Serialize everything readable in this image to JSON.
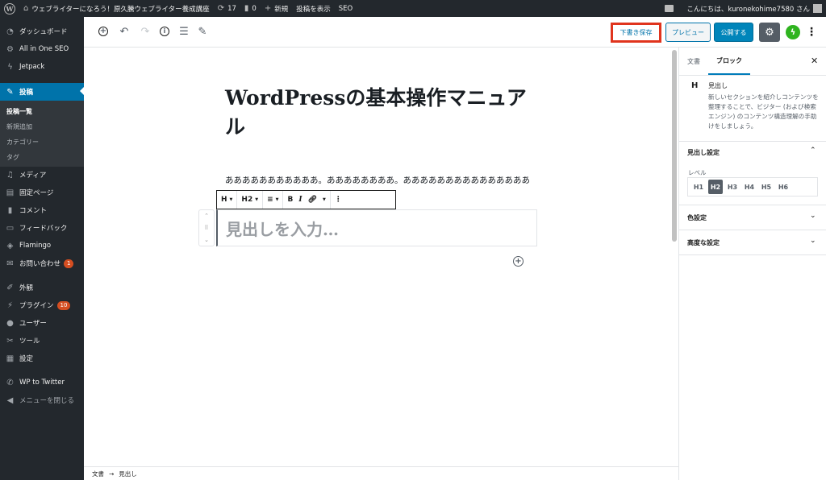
{
  "admin_bar": {
    "site_name": "ウェブライターになろう！原久騰ウェブライター養成講座",
    "updates_count": "17",
    "comments_count": "0",
    "new_label": "新規",
    "view_post_label": "投稿を表示",
    "seo_label": "SEO",
    "greeting": "こんにちは、kuronekohime7580 さん"
  },
  "sidebar": {
    "dashboard": "ダッシュボード",
    "aioseo": "All in One SEO",
    "jetpack": "Jetpack",
    "posts": "投稿",
    "posts_submenu": [
      "投稿一覧",
      "新規追加",
      "カテゴリー",
      "タグ"
    ],
    "media": "メディア",
    "pages": "固定ページ",
    "comments": "コメント",
    "feedback": "フィードバック",
    "flamingo": "Flamingo",
    "contact": "お問い合わせ",
    "contact_badge": "1",
    "appearance": "外観",
    "plugins": "プラグイン",
    "plugins_badge": "10",
    "users": "ユーザー",
    "tools": "ツール",
    "settings": "設定",
    "wp_to_twitter": "WP to Twitter",
    "collapse": "メニューを閉じる"
  },
  "header": {
    "save_draft": "下書き保存",
    "preview": "プレビュー",
    "publish": "公開する"
  },
  "editor": {
    "title": "WordPressの基本操作マニュアル",
    "paragraph": "あああああああああああ。ああああああああ。あああああああああああああああ",
    "heading_placeholder": "見出しを入力…",
    "toolbar": {
      "block_type": "H",
      "level": "H2",
      "bold": "B",
      "italic": "I"
    }
  },
  "panel": {
    "tab_document": "文書",
    "tab_block": "ブロック",
    "block_icon": "H",
    "block_name": "見出し",
    "block_description": "新しいセクションを紹介しコンテンツを整理することで、ビジター (および検索エンジン) のコンテンツ構造理解の手助けをしましょう。",
    "heading_settings": "見出し設定",
    "level_label": "レベル",
    "levels": [
      "H1",
      "H2",
      "H3",
      "H4",
      "H5",
      "H6"
    ],
    "color_settings": "色設定",
    "advanced": "高度な設定"
  },
  "footer": {
    "crumb_document": "文書",
    "separator": "→",
    "crumb_block": "見出し"
  },
  "colors": {
    "admin_dark": "#23282d",
    "accent_blue": "#0073aa",
    "highlight_red": "#e0341d",
    "jetpack_green": "#2fb41f"
  }
}
